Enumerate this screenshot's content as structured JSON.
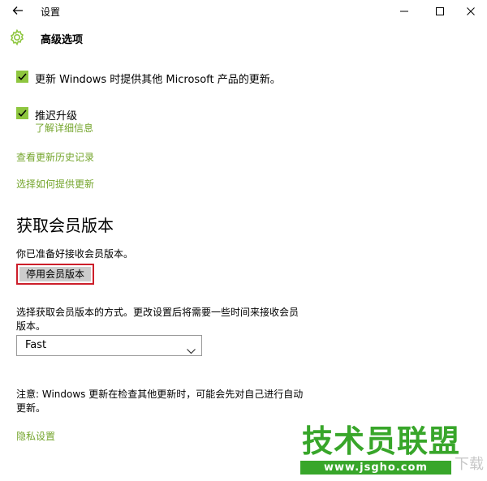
{
  "window": {
    "title": "设置",
    "minimize_glyph": "—",
    "maximize_glyph": "☐",
    "close_glyph": "✕"
  },
  "header": {
    "title": "高级选项",
    "icon": "gear-icon"
  },
  "options": [
    {
      "label": "更新 Windows 时提供其他 Microsoft 产品的更新。",
      "checked": true
    },
    {
      "label": "推迟升级",
      "checked": true,
      "sub_link": "了解详细信息"
    }
  ],
  "links": {
    "history": "查看更新历史记录",
    "delivery": "选择如何提供更新",
    "privacy": "隐私设置"
  },
  "insider": {
    "heading": "获取会员版本",
    "ready_text": "你已准备好接收会员版本。",
    "stop_button": "停用会员版本",
    "choose_text_line1": "选择获取会员版本的方式。更改设置后将需要一些时间来接收会员",
    "choose_text_line2": "版本。",
    "ring_value": "Fast",
    "note_line1": "注意: Windows 更新在检查其他更新时，可能会先对自己进行自动",
    "note_line2": "更新。"
  },
  "watermark": {
    "brand": "技术员联盟",
    "url": "www.jsgho.com",
    "side": "下载"
  },
  "colors": {
    "accent": "#8ec63f",
    "link": "#74a52c",
    "highlight_border": "#cc1e2a",
    "watermark_green": "#38a62a"
  }
}
